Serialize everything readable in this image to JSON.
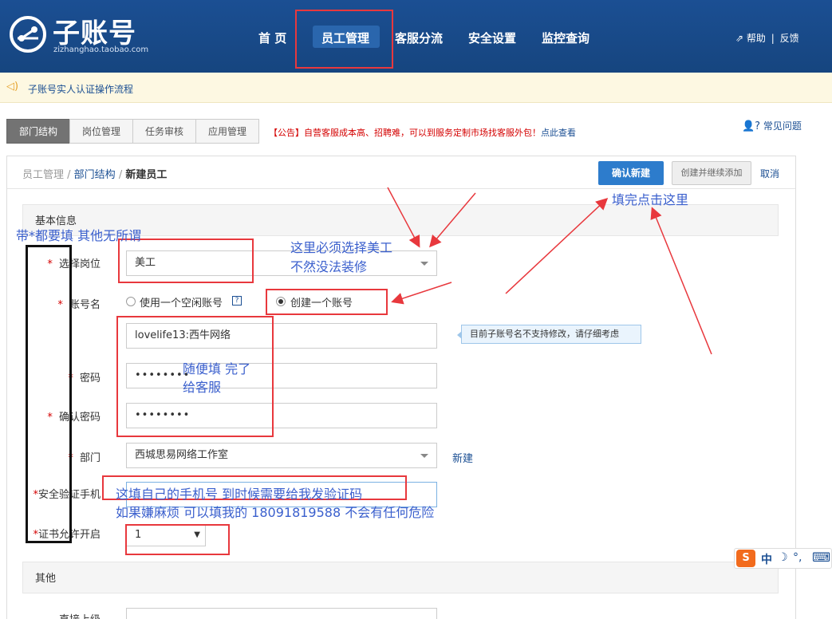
{
  "header": {
    "logo_title": "子账号",
    "logo_domain": "zizhanghao.taobao.com",
    "nav": [
      "首 页",
      "员工管理",
      "客服分流",
      "安全设置",
      "监控查询"
    ],
    "help": "帮助",
    "divider": "|",
    "feedback": "反馈"
  },
  "notice": {
    "text": "子账号实人认证操作流程"
  },
  "tabs": [
    "部门结构",
    "岗位管理",
    "任务审核",
    "应用管理"
  ],
  "announcement": {
    "text": "【公告】自营客服成本高、招聘难，可以到服务定制市场找客服外包！",
    "link": "点此查看"
  },
  "faq": "常见问题",
  "breadcrumb": {
    "item1": "员工管理",
    "sep": " / ",
    "item2": "部门结构",
    "current": "新建员工"
  },
  "actions": {
    "confirm": "确认新建",
    "create_continue": "创建并继续添加",
    "cancel": "取消"
  },
  "form": {
    "section_basic": "基本信息",
    "section_other": "其他",
    "star": "*",
    "post_label": "选择岗位",
    "post_value": "美工",
    "account_label": "账号名",
    "radio_idle": "使用一个空闲账号",
    "help_mark": "?",
    "radio_create": "创建一个账号",
    "account_value": "lovelife13:西牛网络",
    "tip": "目前子账号名不支持修改，请仔细考虑",
    "password_label": "密码",
    "password_value": "••••••••",
    "confirm_label": "确认密码",
    "confirm_value": "••••••••",
    "dept_label": "部门",
    "dept_value": "西城思易网络工作室",
    "dept_new": "新建",
    "phone_label": "安全验证手机",
    "cert_label": "证书允许开启",
    "cert_value": "1",
    "superior_label": "直接上级"
  },
  "annotations": {
    "required_note": "带*都要填 其他无所谓",
    "post_note_1": "这里必须选择美工",
    "post_note_2": "不然没法装修",
    "click_note": "填完点击这里",
    "password_note_1": "随便填 完了",
    "password_note_2": "给客服",
    "phone_note_1": "这填自己的手机号 到时候需要给我发验证码",
    "phone_note_2": "如果嫌麻烦 可以填我的 18091819588  不会有任何危险"
  },
  "ime": {
    "logo": "S",
    "lang": "中",
    "moon": "☽",
    "punct": "°,",
    "keyboard": "⌨"
  },
  "colors": {
    "header_bg": "#1b4f93",
    "primary_button": "#2d7ccc",
    "announcement": "#d40000",
    "annotation_box": "#e8383d",
    "annotation_text": "#3a5fcd"
  }
}
